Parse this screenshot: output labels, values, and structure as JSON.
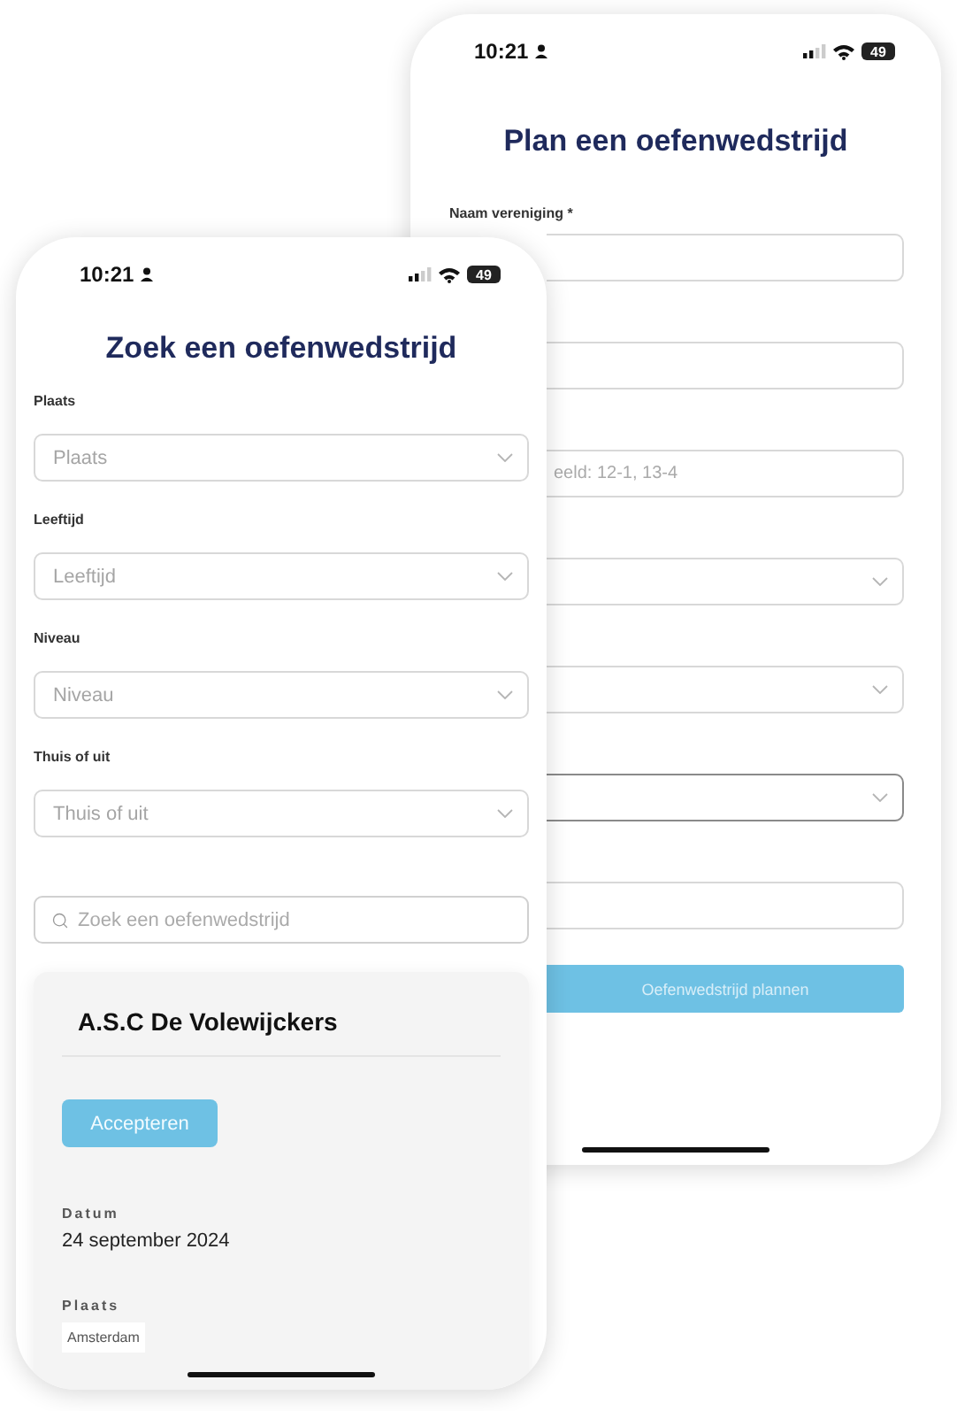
{
  "back_screen": {
    "status_bar": {
      "time": "10:21",
      "battery": "49"
    },
    "title": "Plan een oefenwedstrijd",
    "fields": [
      {
        "kind": "text",
        "label": "Naam vereniging *",
        "focused": false
      },
      {
        "kind": "text",
        "focused": false
      },
      {
        "kind": "text",
        "placeholder": "eeld: 12-1, 13-4",
        "focused": false
      },
      {
        "kind": "select",
        "focused": false
      },
      {
        "kind": "select",
        "focused": false
      },
      {
        "kind": "select",
        "focused": true
      },
      {
        "kind": "text",
        "focused": false
      }
    ],
    "submit_button": "Oefenwedstrijd plannen"
  },
  "front_screen": {
    "status_bar": {
      "time": "10:21",
      "battery": "49"
    },
    "title": "Zoek een oefenwedstrijd",
    "filters": [
      {
        "label": "Plaats",
        "placeholder": "Plaats"
      },
      {
        "label": "Leeftijd",
        "placeholder": "Leeftijd"
      },
      {
        "label": "Niveau",
        "placeholder": "Niveau"
      },
      {
        "label": "Thuis of uit",
        "placeholder": "Thuis of uit"
      }
    ],
    "search": {
      "placeholder": "Zoek een oefenwedstrijd"
    },
    "card": {
      "title": "A.S.C De Volewijckers",
      "button": "Accepteren",
      "details": [
        {
          "kind": "text",
          "label": "Datum",
          "value": "24 september 2024"
        },
        {
          "kind": "tag",
          "label": "Plaats",
          "value": "Amsterdam"
        }
      ]
    }
  }
}
